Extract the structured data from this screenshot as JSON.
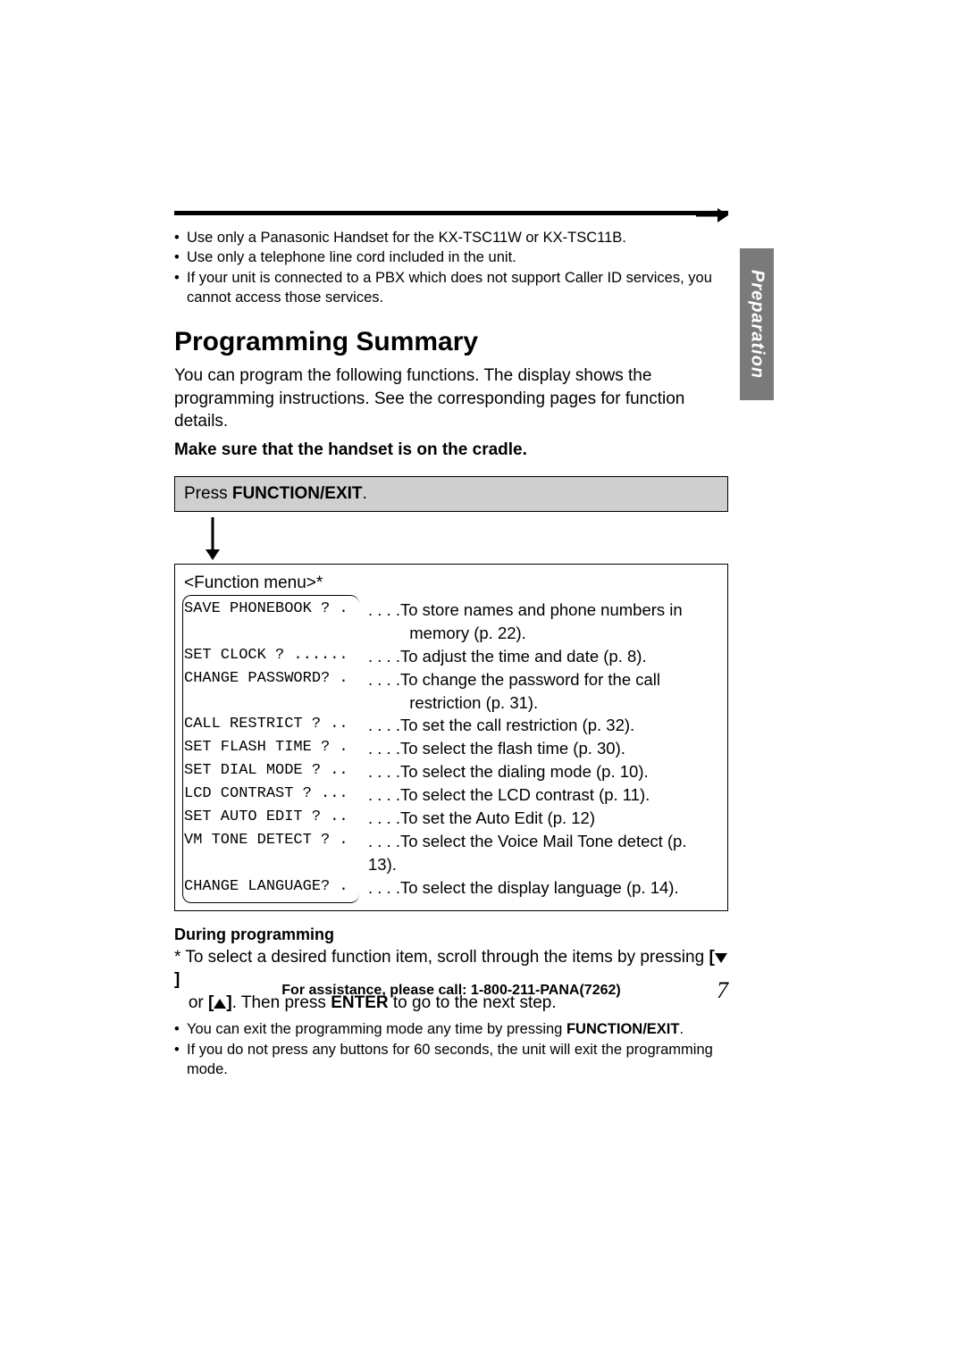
{
  "side_tab": "Preparation",
  "top_notes": [
    "Use only a Panasonic Handset for the KX-TSC11W or KX-TSC11B.",
    "Use only a telephone line cord included in the unit.",
    "If your unit is connected to a PBX which does not support Caller ID services, you cannot access those services."
  ],
  "heading": "Programming Summary",
  "intro": "You can program the following functions. The display shows the programming instructions. See the corresponding pages for function details.",
  "cradle_note": "Make sure that the handset is on the cradle.",
  "press_prefix": "Press ",
  "press_button": "FUNCTION/EXIT",
  "press_suffix": ".",
  "func_menu_title": "<Function menu>*",
  "menu": [
    {
      "lcd": "SAVE PHONEBOOK ? .",
      "desc": ". . . .To store names and phone numbers in\n         memory (p. 22)."
    },
    {
      "lcd": "SET CLOCK ? ......",
      "desc": ". . . .To adjust the time and date (p. 8)."
    },
    {
      "lcd": "CHANGE PASSWORD? .",
      "desc": ". . . .To change the password for the call\n         restriction (p. 31)."
    },
    {
      "lcd": "CALL RESTRICT ? ..",
      "desc": ". . . .To set the call restriction (p. 32)."
    },
    {
      "lcd": "SET FLASH TIME ? .",
      "desc": ". . . .To select the flash time (p. 30)."
    },
    {
      "lcd": "SET DIAL MODE ? ..",
      "desc": ". . . .To select the dialing mode (p. 10)."
    },
    {
      "lcd": "LCD CONTRAST ? ...",
      "desc": ". . . .To select the LCD contrast (p. 11)."
    },
    {
      "lcd": "SET AUTO EDIT ? ..",
      "desc": ". . . .To set the Auto Edit (p. 12)"
    },
    {
      "lcd": "VM TONE DETECT ? .",
      "desc": ". . . .To select the Voice Mail Tone detect (p. 13)."
    },
    {
      "lcd": "CHANGE LANGUAGE? .",
      "desc": ". . . .To select the display language (p. 14)."
    }
  ],
  "during_heading": "During programming",
  "during_p1_a": "* To select a desired function item, scroll through the items by pressing ",
  "during_p1_b": " or ",
  "during_p1_c": ". Then press ",
  "during_p1_enter": "ENTER",
  "during_p1_d": " to go to the next step.",
  "during_notes_a": "You can exit the programming mode any time by pressing ",
  "during_notes_a_btn": "FUNCTION/EXIT",
  "during_notes_a_end": ".",
  "during_notes_b": "If you do not press any buttons for 60 seconds, the unit will exit the programming mode.",
  "footer": "For assistance, please call: 1-800-211-PANA(7262)",
  "page_number": "7"
}
